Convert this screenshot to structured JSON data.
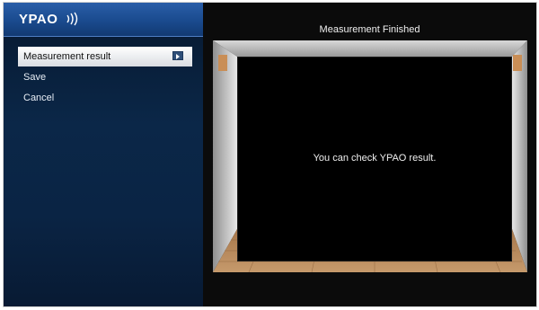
{
  "logo": {
    "text": "YPAO"
  },
  "menu": {
    "items": [
      {
        "label": "Measurement result",
        "selected": true
      },
      {
        "label": "Save",
        "selected": false
      },
      {
        "label": "Cancel",
        "selected": false
      }
    ]
  },
  "main": {
    "title": "Measurement Finished",
    "message": "You can check YPAO result."
  },
  "colors": {
    "logo_bar": "#1a4a8e",
    "menu_bg": "#0b2748",
    "selected_item": "#e6e8eb",
    "floor_wood": "#b98a5a"
  }
}
